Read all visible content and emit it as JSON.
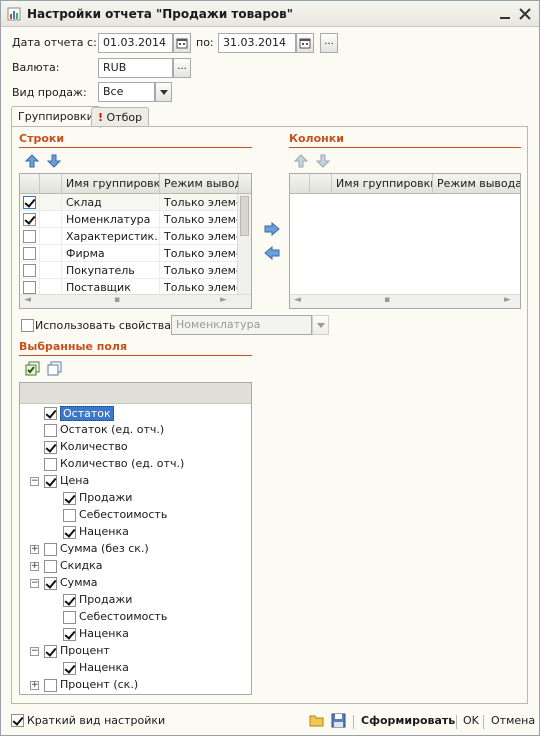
{
  "window": {
    "title": "Настройки отчета \"Продажи товаров\""
  },
  "form": {
    "date_label": "Дата отчета с:",
    "date_from": "01.03.2014",
    "to_label": "по:",
    "date_to": "31.03.2014",
    "ellipsis": "...",
    "currency_label": "Валюта:",
    "currency": "RUB",
    "sale_type_label": "Вид продаж:",
    "sale_type": "Все"
  },
  "tabs": [
    {
      "label": "Группировки"
    },
    {
      "label": "Отбор"
    }
  ],
  "rows_section": {
    "title": "Строки",
    "columns": [
      "Имя группировки",
      "Режим вывода"
    ],
    "rows": [
      {
        "checked": true,
        "name": "Склад",
        "mode": "Только элементы"
      },
      {
        "checked": true,
        "name": "Номенклатура",
        "mode": "Только элементы"
      },
      {
        "checked": false,
        "name": "Характеристик...",
        "mode": "Только элементы"
      },
      {
        "checked": false,
        "name": "Фирма",
        "mode": "Только элементы"
      },
      {
        "checked": false,
        "name": "Покупатель",
        "mode": "Только элементы"
      },
      {
        "checked": false,
        "name": "Поставщик",
        "mode": "Только элементы"
      }
    ]
  },
  "columns_section": {
    "title": "Колонки",
    "columns": [
      "Имя группировки",
      "Режим вывода"
    ]
  },
  "use_properties": {
    "label": "Использовать свойства",
    "value": "Номенклатура"
  },
  "fields_section": {
    "title": "Выбранные поля",
    "items": [
      {
        "label": "Остаток",
        "checked": true,
        "level": 0,
        "expander": "",
        "selected": true
      },
      {
        "label": "Остаток (ед. отч.)",
        "checked": false,
        "level": 0,
        "expander": ""
      },
      {
        "label": "Количество",
        "checked": true,
        "level": 0,
        "expander": ""
      },
      {
        "label": "Количество (ед. отч.)",
        "checked": false,
        "level": 0,
        "expander": ""
      },
      {
        "label": "Цена",
        "checked": true,
        "level": 0,
        "expander": "−"
      },
      {
        "label": "Продажи",
        "checked": true,
        "level": 1,
        "expander": ""
      },
      {
        "label": "Себестоимость",
        "checked": false,
        "level": 1,
        "expander": ""
      },
      {
        "label": "Наценка",
        "checked": true,
        "level": 1,
        "expander": ""
      },
      {
        "label": "Сумма (без ск.)",
        "checked": false,
        "level": 0,
        "expander": "+"
      },
      {
        "label": "Скидка",
        "checked": false,
        "level": 0,
        "expander": "+"
      },
      {
        "label": "Сумма",
        "checked": true,
        "level": 0,
        "expander": "−"
      },
      {
        "label": "Продажи",
        "checked": true,
        "level": 1,
        "expander": ""
      },
      {
        "label": "Себестоимость",
        "checked": false,
        "level": 1,
        "expander": ""
      },
      {
        "label": "Наценка",
        "checked": true,
        "level": 1,
        "expander": ""
      },
      {
        "label": "Процент",
        "checked": true,
        "level": 0,
        "expander": "−"
      },
      {
        "label": "Наценка",
        "checked": true,
        "level": 1,
        "expander": ""
      },
      {
        "label": "Процент (ск.)",
        "checked": false,
        "level": 0,
        "expander": "+"
      }
    ]
  },
  "footer": {
    "brief_label": "Краткий вид настройки",
    "brief_checked": true,
    "generate": "Сформировать",
    "ok": "OK",
    "cancel": "Отмена"
  },
  "colors": {
    "section_title": "#c8501e",
    "selection": "#3c77c8"
  }
}
